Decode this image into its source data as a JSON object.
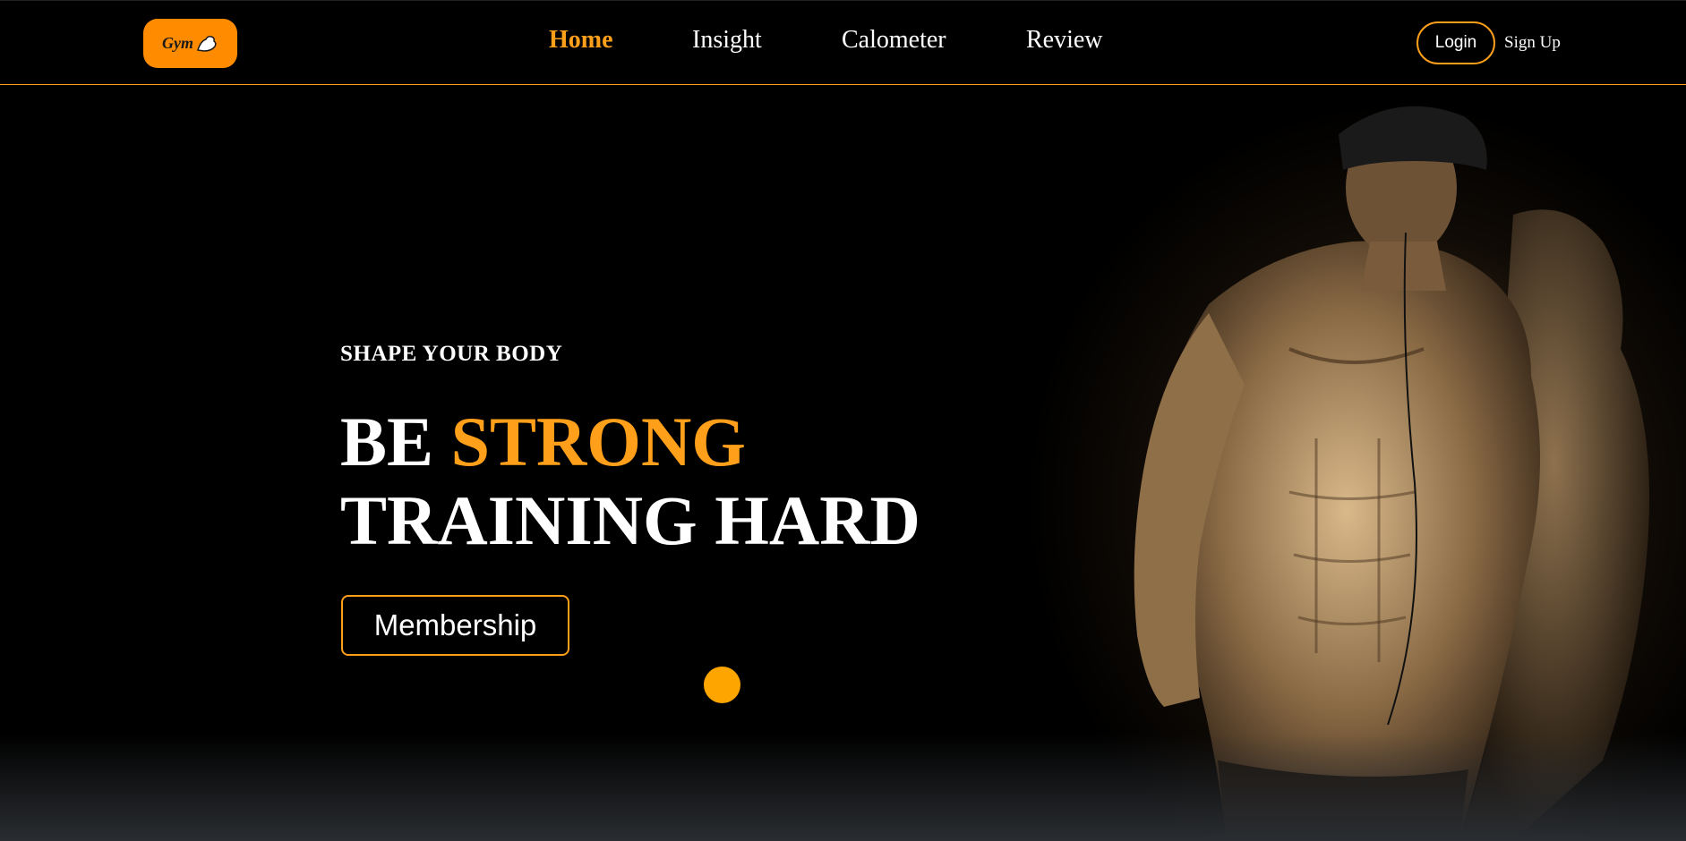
{
  "header": {
    "logo_text": "Gym",
    "nav": [
      {
        "label": "Home",
        "active": true
      },
      {
        "label": "Insight",
        "active": false
      },
      {
        "label": "Calometer",
        "active": false
      },
      {
        "label": "Review",
        "active": false
      }
    ],
    "login_label": "Login",
    "signup_label": "Sign Up"
  },
  "hero": {
    "tagline": "SHAPE YOUR BODY",
    "headline_line1_word1": "BE",
    "headline_line1_accent": "STRONG",
    "headline_line2": "TRAINING HARD",
    "cta_label": "Membership"
  },
  "colors": {
    "accent": "#ff9f1a",
    "logo_bg": "#ff8c00",
    "background": "#000000",
    "dot": "#ffa500"
  },
  "icons": {
    "logo_mark": "flexing-arm-icon",
    "hero_image": "athlete-photo"
  }
}
